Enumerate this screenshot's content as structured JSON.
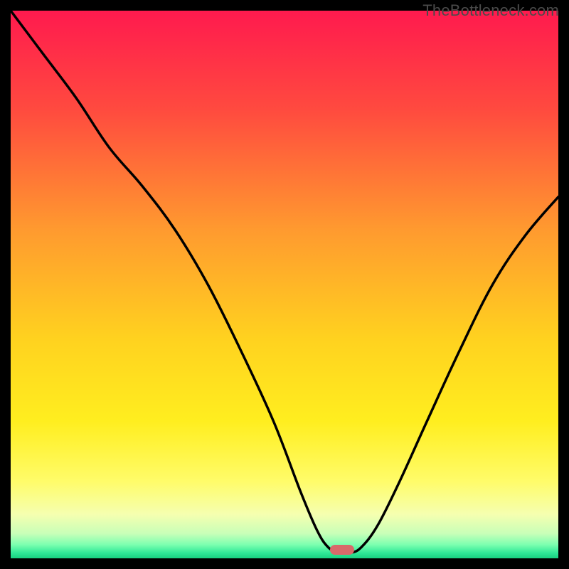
{
  "watermark": "TheBottleneck.com",
  "colors": {
    "frame": "#000000",
    "marker": "#d86a6a",
    "curve": "#000000",
    "gradient_stops": [
      {
        "offset": 0.0,
        "color": "#ff1a4e"
      },
      {
        "offset": 0.18,
        "color": "#ff4a3f"
      },
      {
        "offset": 0.4,
        "color": "#ff9a2f"
      },
      {
        "offset": 0.6,
        "color": "#ffd21f"
      },
      {
        "offset": 0.75,
        "color": "#ffee1f"
      },
      {
        "offset": 0.86,
        "color": "#fffc6a"
      },
      {
        "offset": 0.92,
        "color": "#f5ffb0"
      },
      {
        "offset": 0.955,
        "color": "#c8ffb8"
      },
      {
        "offset": 0.975,
        "color": "#7cffb0"
      },
      {
        "offset": 0.99,
        "color": "#30e897"
      },
      {
        "offset": 1.0,
        "color": "#18d080"
      }
    ]
  },
  "marker_position": {
    "x_pct": 0.605,
    "y_pct": 0.985
  },
  "chart_data": {
    "type": "line",
    "title": "",
    "xlabel": "",
    "ylabel": "",
    "xlim": [
      0,
      100
    ],
    "ylim": [
      0,
      100
    ],
    "annotations": [
      "TheBottleneck.com"
    ],
    "series": [
      {
        "name": "bottleneck-curve",
        "x": [
          0,
          6,
          12,
          18,
          24,
          30,
          36,
          42,
          48,
          53,
          56,
          58,
          60,
          62,
          64,
          67,
          71,
          76,
          82,
          88,
          94,
          100
        ],
        "y": [
          100,
          92,
          84,
          75,
          68,
          60,
          50,
          38,
          25,
          12,
          5,
          2,
          1,
          1,
          2,
          6,
          14,
          25,
          38,
          50,
          59,
          66
        ]
      }
    ],
    "optimum_marker": {
      "x": 60.5,
      "y": 1.5
    },
    "note": "x/y are percentages of the plot area; y=0 is bottom (green), y=100 is top (red). Values estimated from pixel positions."
  }
}
